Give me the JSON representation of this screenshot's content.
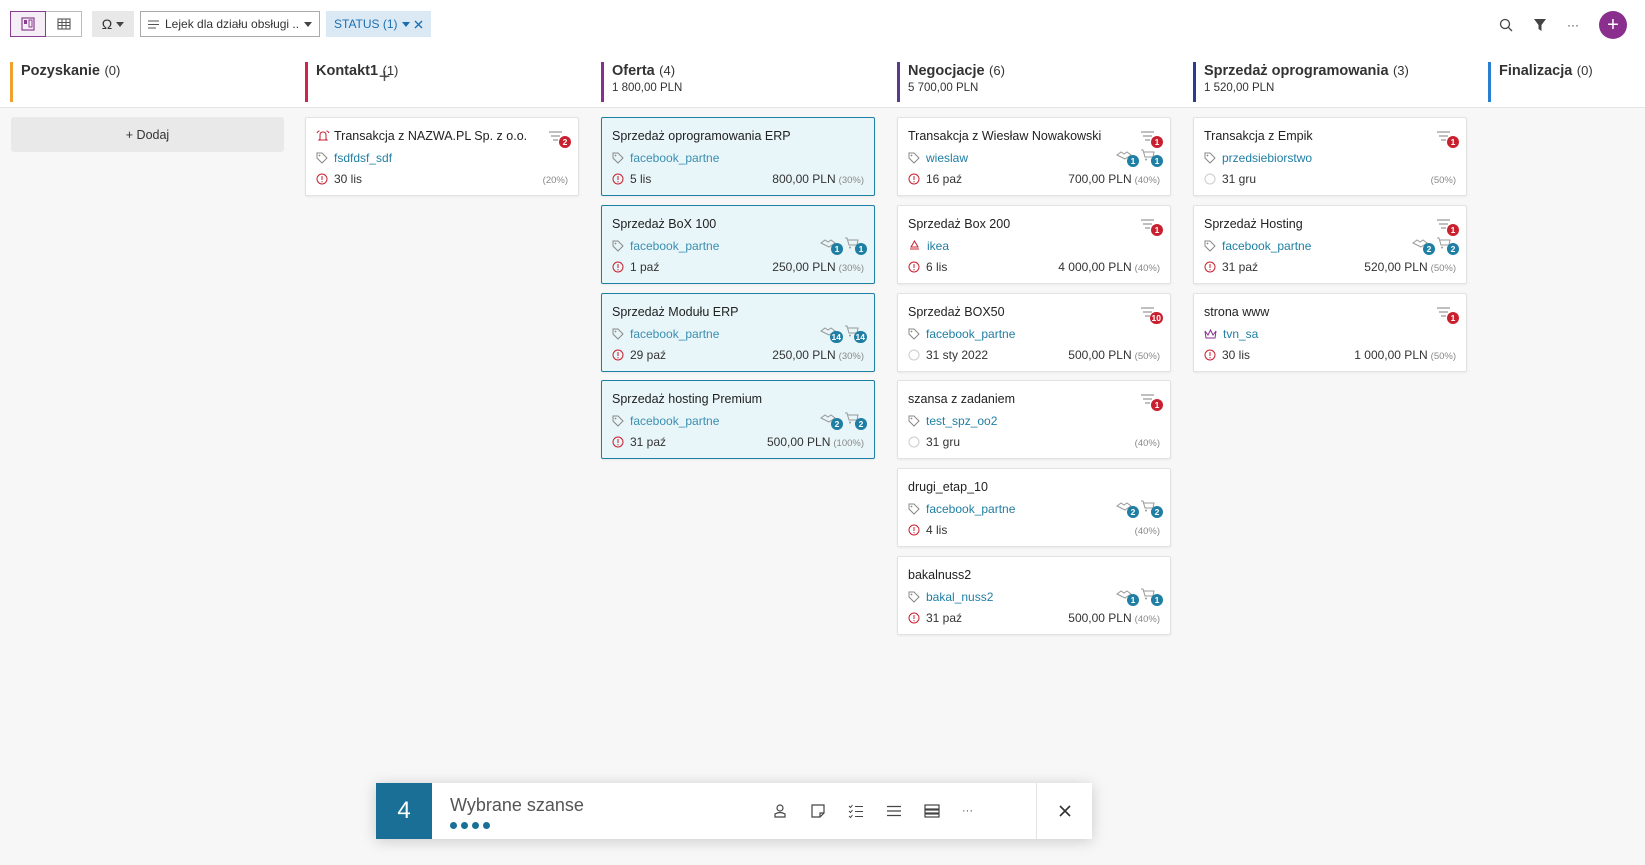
{
  "toolbar": {
    "funnel_select": "Lejek dla działu obsługi ...",
    "status_chip": "STATUS (1)",
    "more": "···",
    "add": "+"
  },
  "columns": [
    {
      "name": "Pozyskanie",
      "count": "(0)",
      "sum": "",
      "color": "#f0a030"
    },
    {
      "name": "Kontakt1",
      "count": "(1)",
      "sum": "",
      "color": "#d0254a"
    },
    {
      "name": "Oferta",
      "count": "(4)",
      "sum": "1 800,00 PLN",
      "color": "#8b2f8f"
    },
    {
      "name": "Negocjacje",
      "count": "(6)",
      "sum": "5 700,00 PLN",
      "color": "#5a3a8f"
    },
    {
      "name": "Sprzedaż oprogramowania",
      "count": "(3)",
      "sum": "1 520,00 PLN",
      "color": "#2d3c8f"
    },
    {
      "name": "Finalizacja",
      "count": "(0)",
      "sum": "",
      "color": "#2a7fd0"
    }
  ],
  "add_button": "+ Dodaj",
  "cards": {
    "kontakt": [
      {
        "title": "Transakcja z NAZWA.PL Sp. z o.o.",
        "tag": "fsdfdsf_sdf",
        "date": "30 lis",
        "amount": "",
        "pct": "(20%)",
        "task_badge": "2"
      }
    ],
    "oferta": [
      {
        "title": "Sprzedaż oprogramowania ERP",
        "tag": "facebook_partne",
        "date": "5 lis",
        "amount": "800,00 PLN",
        "pct": "(30%)"
      },
      {
        "title": "Sprzedaż BoX 100",
        "tag": "facebook_partne",
        "date": "1 paź",
        "amount": "250,00 PLN",
        "pct": "(30%)",
        "b1": "1",
        "b2": "1"
      },
      {
        "title": "Sprzedaż Modułu ERP",
        "tag": "facebook_partne",
        "date": "29 paź",
        "amount": "250,00 PLN",
        "pct": "(30%)",
        "b1": "14",
        "b2": "14"
      },
      {
        "title": "Sprzedaż hosting Premium",
        "tag": "facebook_partne",
        "date": "31 paź",
        "amount": "500,00 PLN",
        "pct": "(100%)",
        "b1": "2",
        "b2": "2"
      }
    ],
    "negocjacje": [
      {
        "title": "Transakcja z Wiesław Nowakowski",
        "tag": "wieslaw",
        "date": "16 paź",
        "amount": "700,00 PLN",
        "pct": "(40%)",
        "task_badge": "1",
        "b1": "1",
        "b2": "1"
      },
      {
        "title": "Sprzedaż Box 200",
        "tag": "ikea",
        "date": "6 lis",
        "amount": "4 000,00 PLN",
        "pct": "(40%)",
        "task_badge": "1"
      },
      {
        "title": "Sprzedaż BOX50",
        "tag": "facebook_partne",
        "date": "31 sty 2022",
        "amount": "500,00 PLN",
        "pct": "(50%)",
        "task_badge": "10"
      },
      {
        "title": "szansa z zadaniem",
        "tag": "test_spz_oo2",
        "date": "31 gru",
        "amount": "",
        "pct": "(40%)",
        "task_badge": "1"
      },
      {
        "title": "drugi_etap_10",
        "tag": "facebook_partne",
        "date": "4 lis",
        "amount": "",
        "pct": "(40%)",
        "b1": "2",
        "b2": "2"
      },
      {
        "title": "bakalnuss2",
        "tag": "bakal_nuss2",
        "date": "31 paź",
        "amount": "500,00 PLN",
        "pct": "(40%)",
        "b1": "1",
        "b2": "1"
      }
    ],
    "sprzedaz": [
      {
        "title": "Transakcja z Empik",
        "tag": "przedsiebiorstwo",
        "date": "31 gru",
        "amount": "",
        "pct": "(50%)",
        "task_badge": "1"
      },
      {
        "title": "Sprzedaż Hosting",
        "tag": "facebook_partne",
        "date": "31 paź",
        "amount": "520,00 PLN",
        "pct": "(50%)",
        "task_badge": "1",
        "b1": "2",
        "b2": "2"
      },
      {
        "title": "strona www",
        "tag": "tvn_sa",
        "date": "30 lis",
        "amount": "1 000,00 PLN",
        "pct": "(50%)",
        "task_badge": "1"
      }
    ]
  },
  "selection_bar": {
    "count": "4",
    "label": "Wybrane szanse",
    "more": "···"
  },
  "colors": {
    "accent": "#8b2f8f",
    "selected_border": "#1f7ea3",
    "badge_red": "#c8202f",
    "badge_blue": "#1f7ea3"
  }
}
